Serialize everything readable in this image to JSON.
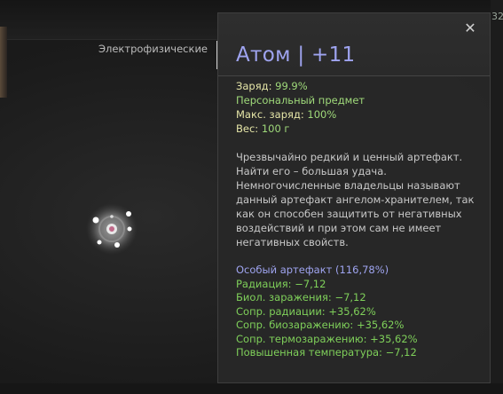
{
  "category": "Электрофизические",
  "corner_text": "32",
  "tooltip": {
    "title": "Атом | +11",
    "close_glyph": "✕",
    "stats": {
      "charge_label": "Заряд: ",
      "charge_value": "99.9%",
      "personal": "Персональный предмет",
      "max_charge_label": "Макс. заряд: ",
      "max_charge_value": "100%",
      "weight_label": "Вес: ",
      "weight_value": "100 г"
    },
    "description": "Чрезвычайно редкий и ценный артефакт. Найти его – большая удача. Немногочисленные владельцы называют данный артефакт ангелом-хранителем, так как он способен защитить от негативных воздействий и при этом сам не имеет негативных свойств.",
    "special": "Особый артефакт (116,78%)",
    "effects": [
      "Радиация: −7,12",
      "Биол. заражения: −7,12",
      "Сопр. радиации: +35,62%",
      "Сопр. биозаражению: +35,62%",
      "Сопр. термозаражению: +35,62%",
      "Повышенная температура: −7,12"
    ]
  },
  "colors": {
    "title": "#9fa4f0",
    "stat_label": "#e6e6a8",
    "stat_value": "#9fd97a",
    "effect": "#7fd05a",
    "special": "#9fa4f0"
  }
}
